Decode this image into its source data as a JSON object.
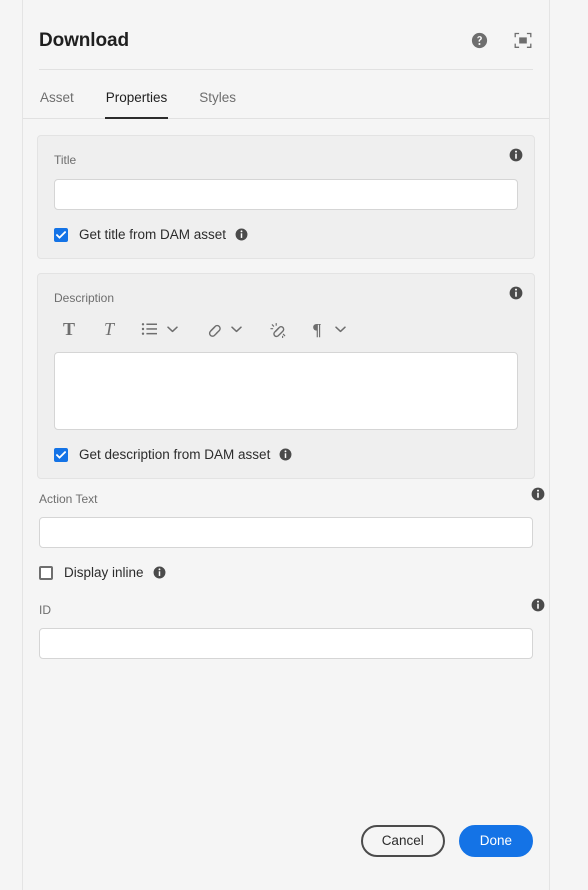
{
  "dialog": {
    "title": "Download",
    "header_actions": [
      {
        "name": "help-icon",
        "label": "Help"
      },
      {
        "name": "fullscreen-icon",
        "label": "Full screen"
      }
    ]
  },
  "tabs": [
    {
      "label": "Asset",
      "selected": false
    },
    {
      "label": "Properties",
      "selected": true
    },
    {
      "label": "Styles",
      "selected": false
    }
  ],
  "fields": {
    "title": {
      "label": "Title",
      "value": "",
      "placeholder": "",
      "info_icon": "info-icon",
      "checkbox": {
        "label": "Get title from DAM asset",
        "checked": true,
        "info_icon": "info-icon"
      }
    },
    "description": {
      "label": "Description",
      "value": "",
      "placeholder": "",
      "info_icon": "info-icon",
      "toolbar": [
        {
          "name": "bold-icon",
          "glyph": "T",
          "label": "Bold"
        },
        {
          "name": "italic-icon",
          "glyph": "T",
          "label": "Italic"
        },
        {
          "name": "bulleted-list-icon",
          "label": "Lists"
        },
        {
          "name": "chevron-down-icon",
          "label": "List options"
        },
        {
          "name": "link-icon",
          "label": "Link"
        },
        {
          "name": "chevron-down-icon",
          "label": "Link options"
        },
        {
          "name": "unlink-icon",
          "label": "Unlink"
        },
        {
          "name": "paragraph-icon",
          "glyph": "¶",
          "label": "Paragraph format"
        },
        {
          "name": "chevron-down-icon",
          "label": "Paragraph options"
        }
      ],
      "checkbox": {
        "label": "Get description from DAM asset",
        "checked": true,
        "info_icon": "info-icon"
      }
    },
    "action_text": {
      "label": "Action Text",
      "value": "",
      "placeholder": "",
      "info_icon": "info-icon"
    },
    "display_inline": {
      "label": "Display inline",
      "checked": false,
      "info_icon": "info-icon"
    },
    "id": {
      "label": "ID",
      "value": "",
      "placeholder": "",
      "info_icon": "info-icon"
    }
  },
  "footer": {
    "cancel_label": "Cancel",
    "done_label": "Done"
  },
  "colors": {
    "accent": "#1473e6",
    "page_bg": "#f5f5f5",
    "panel_bg": "#efefef",
    "text": "#2c2c2c",
    "muted_text": "#6e6e6e"
  }
}
